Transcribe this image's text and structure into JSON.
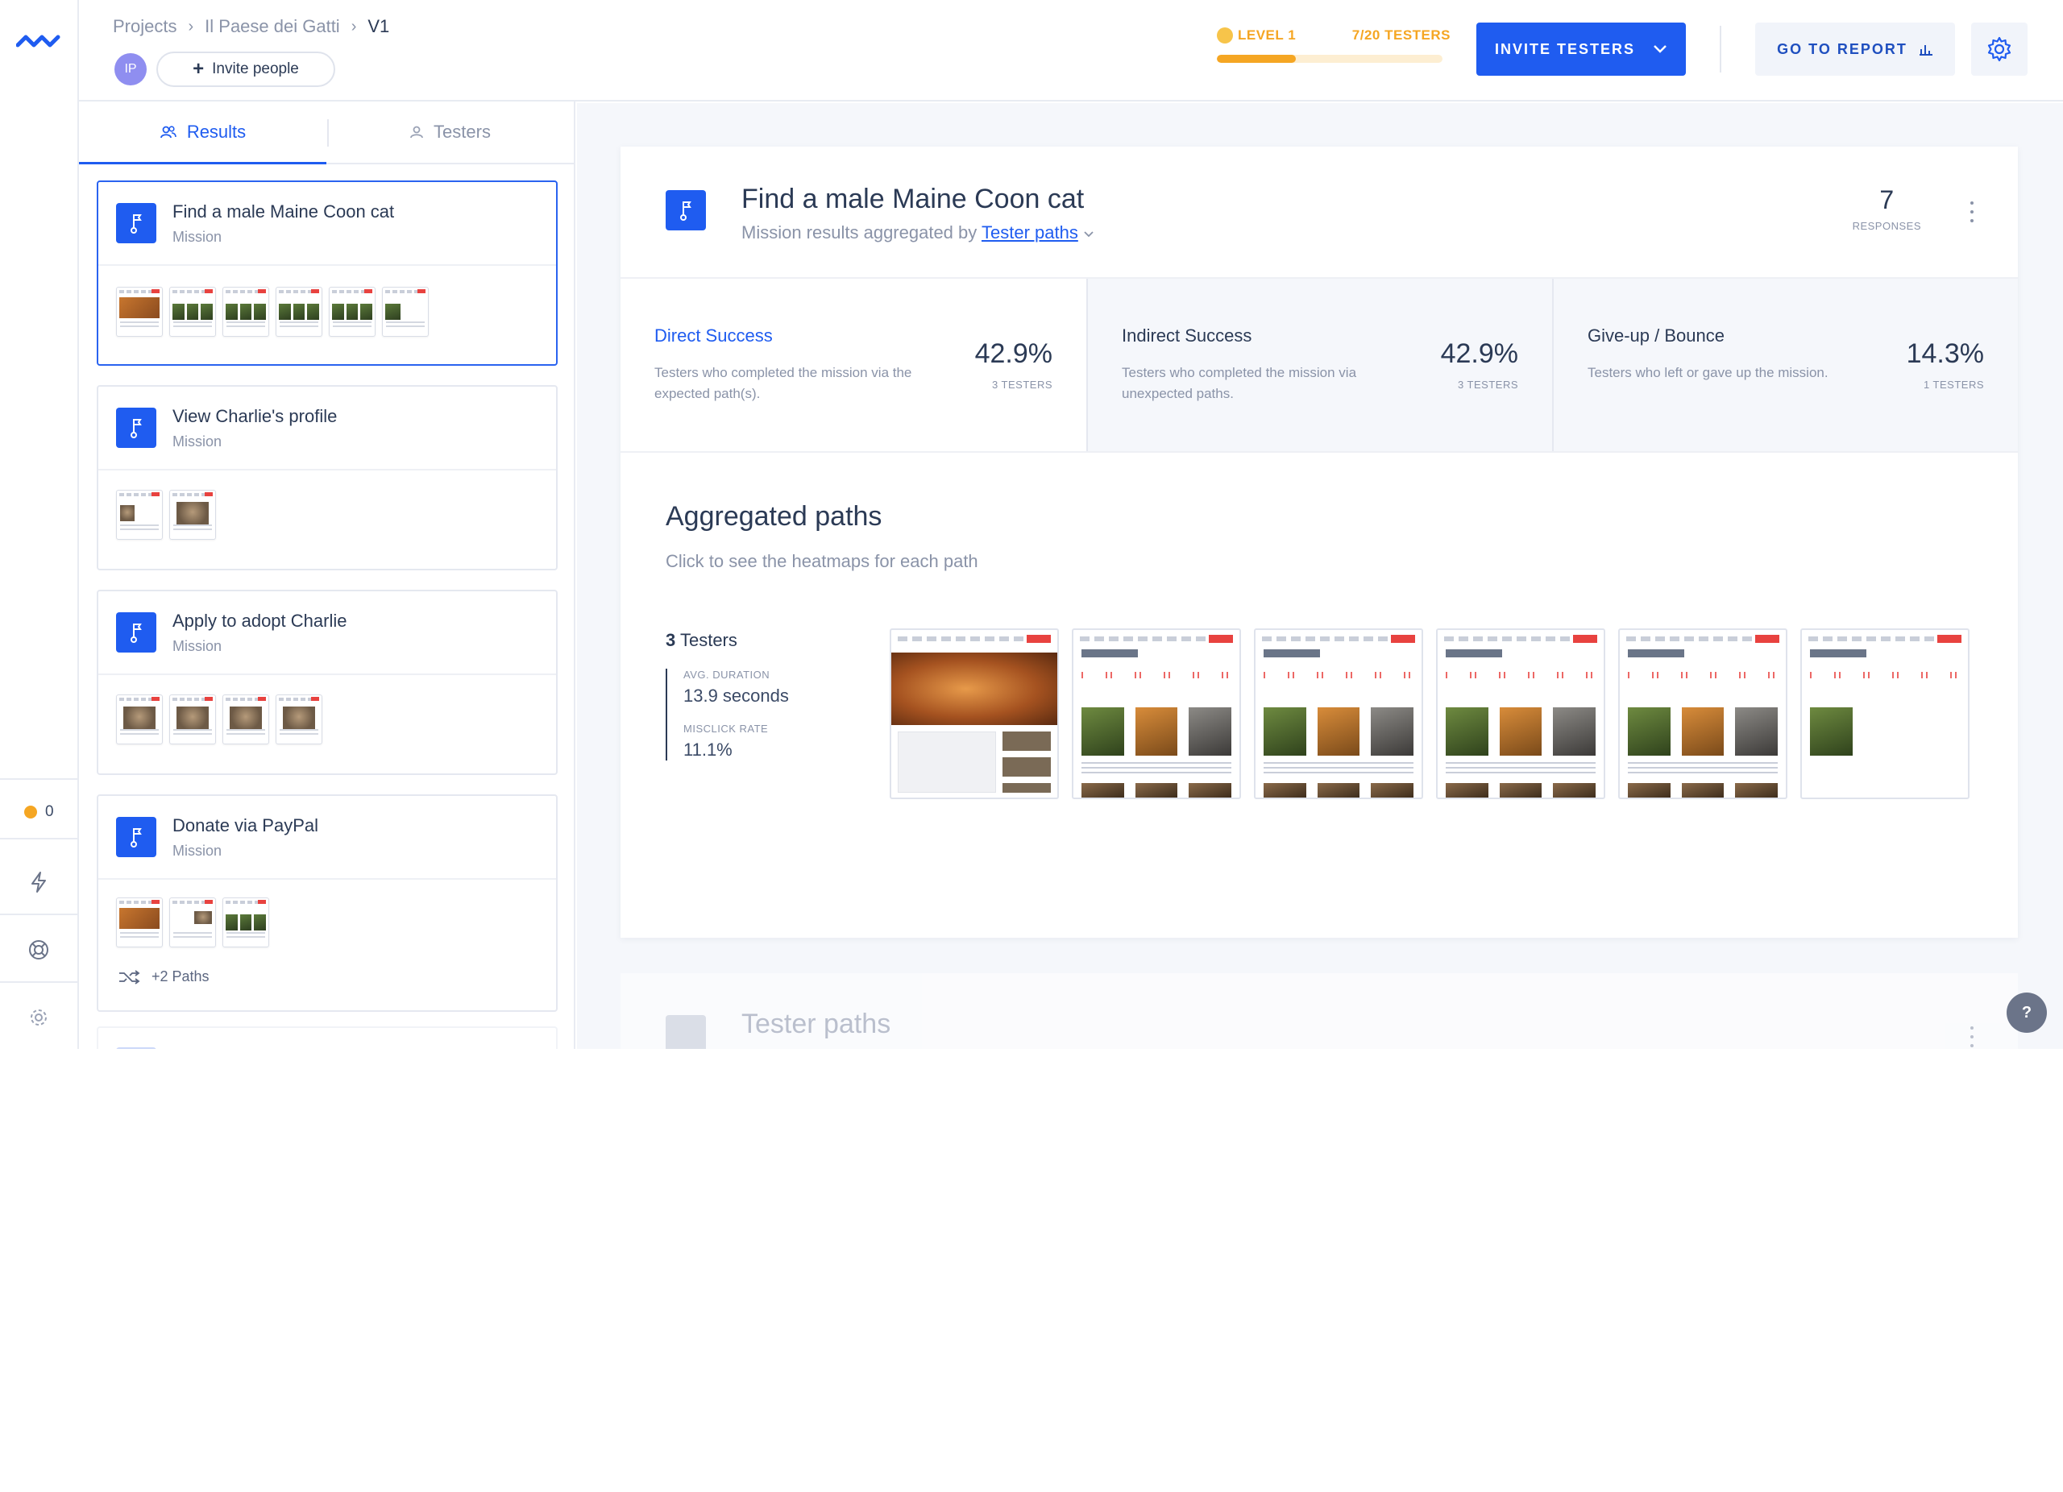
{
  "breadcrumb": {
    "items": [
      "Projects",
      "Il Paese dei Gatti"
    ],
    "current": "V1"
  },
  "header": {
    "avatar_initials": "IP",
    "invite_people_label": "Invite people",
    "level_label": "LEVEL 1",
    "testers_count": "7/20 TESTERS",
    "level_progress": 0.35,
    "invite_testers_label": "INVITE TESTERS",
    "go_to_report_label": "GO TO REPORT"
  },
  "rail": {
    "credit_count": "0"
  },
  "tabs": [
    {
      "label": "Results",
      "active": true
    },
    {
      "label": "Testers",
      "active": false
    }
  ],
  "missions": [
    {
      "title": "Find a male Maine Coon cat",
      "type": "Mission",
      "selected": true
    },
    {
      "title": "View Charlie's profile",
      "type": "Mission",
      "selected": false
    },
    {
      "title": "Apply to adopt Charlie",
      "type": "Mission",
      "selected": false
    },
    {
      "title": "Donate via PayPal",
      "type": "Mission",
      "selected": false,
      "extra_paths": "+2 Paths"
    }
  ],
  "main": {
    "title": "Find a male Maine Coon cat",
    "subtitle_prefix": "Mission results aggregated by",
    "subtitle_link": "Tester paths",
    "responses_value": "7",
    "responses_label": "RESPONSES",
    "stats": [
      {
        "title": "Direct Success",
        "desc": "Testers who completed the mission via the expected path(s).",
        "value": "42.9%",
        "sub": "3 TESTERS"
      },
      {
        "title": "Indirect Success",
        "desc": "Testers who completed the mission via unexpected paths.",
        "value": "42.9%",
        "sub": "3 TESTERS"
      },
      {
        "title": "Give-up / Bounce",
        "desc": "Testers who left or gave up the mission.",
        "value": "14.3%",
        "sub": "1 TESTERS"
      }
    ],
    "aggregated_title": "Aggregated paths",
    "aggregated_sub": "Click to see the heatmaps for each path",
    "path": {
      "testers_num": "3",
      "testers_word": "Testers",
      "duration_label": "AVG. DURATION",
      "duration_value": "13.9 seconds",
      "misclick_label": "MISCLICK RATE",
      "misclick_value": "11.1%"
    },
    "tester_paths_title": "Tester paths"
  },
  "help_label": "?",
  "colors": {
    "accent": "#1f5cf0",
    "warning": "#f5a623",
    "text": "#2b3a55",
    "muted": "#8a93a8"
  }
}
